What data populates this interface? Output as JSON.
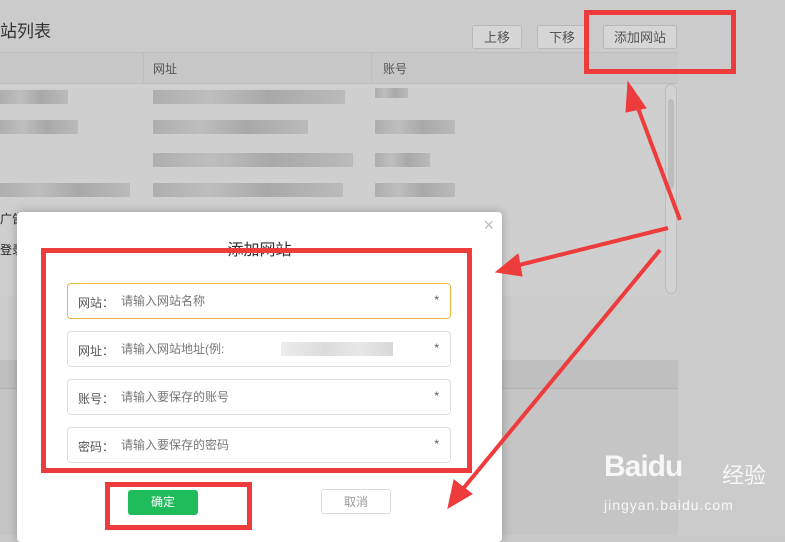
{
  "page": {
    "title": "站列表",
    "toolbar": {
      "move_up": "上移",
      "move_down": "下移",
      "add_site": "添加网站"
    },
    "table": {
      "columns": [
        "网址",
        "账号"
      ]
    },
    "side_labels": [
      "广告",
      "登录"
    ]
  },
  "dialog": {
    "title": "添加网站",
    "close_symbol": "×",
    "fields": [
      {
        "label": "网站：",
        "placeholder": "请输入网站名称",
        "required": "*"
      },
      {
        "label": "网址：",
        "placeholder": "请输入网站地址(例:",
        "required": "*"
      },
      {
        "label": "账号：",
        "placeholder": "请输入要保存的账号",
        "required": "*"
      },
      {
        "label": "密码：",
        "placeholder": "请输入要保存的密码",
        "required": "*"
      }
    ],
    "confirm": "确定",
    "cancel": "取消"
  },
  "watermark": {
    "logo": "Baidu",
    "brand": "经验",
    "url": "jingyan.baidu.com"
  },
  "colors": {
    "highlight": "#ee3b3b",
    "confirm_green": "#1fbc5c",
    "active_border": "#f0b43c"
  }
}
